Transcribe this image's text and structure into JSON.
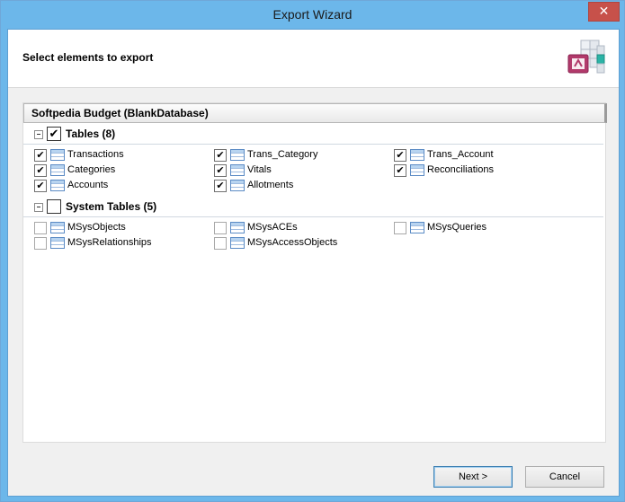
{
  "window": {
    "title": "Export Wizard",
    "close_glyph": "✕"
  },
  "header": {
    "text": "Select elements to export",
    "icon": "database-export-icon"
  },
  "tree": {
    "root_label": "Softpedia Budget (BlankDatabase)",
    "groups": [
      {
        "label": "Tables (8)",
        "checked": true,
        "items": [
          {
            "label": "Transactions",
            "checked": true
          },
          {
            "label": "Trans_Category",
            "checked": true
          },
          {
            "label": "Trans_Account",
            "checked": true
          },
          {
            "label": "Categories",
            "checked": true
          },
          {
            "label": "Vitals",
            "checked": true
          },
          {
            "label": "Reconciliations",
            "checked": true
          },
          {
            "label": "Accounts",
            "checked": true
          },
          {
            "label": "Allotments",
            "checked": true
          }
        ]
      },
      {
        "label": "System Tables (5)",
        "checked": false,
        "items": [
          {
            "label": "MSysObjects",
            "checked": false
          },
          {
            "label": "MSysACEs",
            "checked": false
          },
          {
            "label": "MSysQueries",
            "checked": false
          },
          {
            "label": "MSysRelationships",
            "checked": false
          },
          {
            "label": "MSysAccessObjects",
            "checked": false
          }
        ]
      }
    ]
  },
  "buttons": {
    "next": "Next >",
    "cancel": "Cancel"
  },
  "colors": {
    "titlebar": "#6cb7ea",
    "close": "#c7514a"
  },
  "check_glyph": "✔"
}
